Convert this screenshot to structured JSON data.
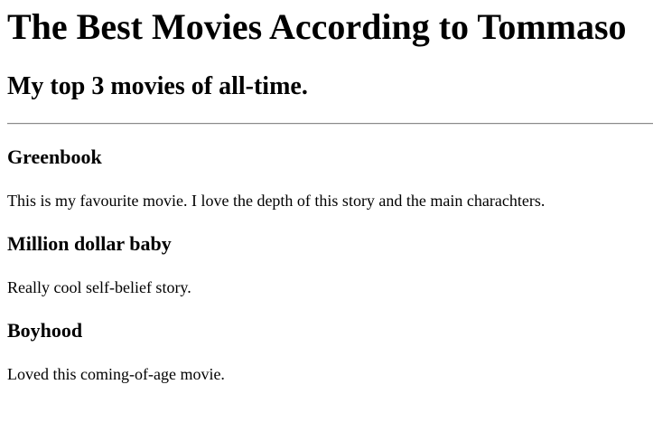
{
  "page": {
    "title": "The Best Movies According to Tommaso",
    "subtitle": "My top 3 movies of all-time."
  },
  "movies": [
    {
      "title": "Greenbook",
      "description": "This is my favourite movie. I love the depth of this story and the main charachters."
    },
    {
      "title": "Million dollar baby",
      "description": "Really cool self-belief story."
    },
    {
      "title": "Boyhood",
      "description": "Loved this coming-of-age movie."
    }
  ]
}
